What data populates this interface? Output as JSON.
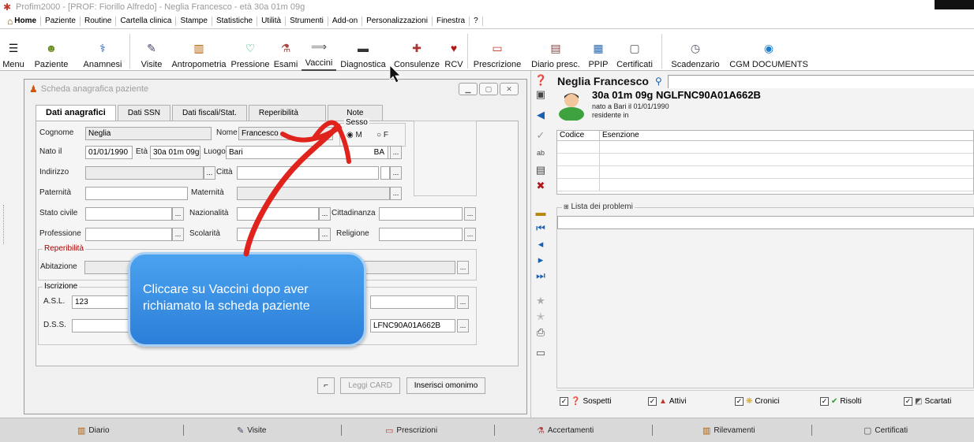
{
  "window": {
    "title": "Profim2000 - [PROF: Fiorillo Alfredo] - Neglia Francesco - età 30a 01m 09g"
  },
  "menu": [
    {
      "label": "Home"
    },
    {
      "label": "Paziente"
    },
    {
      "label": "Routine"
    },
    {
      "label": "Cartella clinica"
    },
    {
      "label": "Stampe"
    },
    {
      "label": "Statistiche"
    },
    {
      "label": "Utilità"
    },
    {
      "label": "Strumenti"
    },
    {
      "label": "Add-on"
    },
    {
      "label": "Personalizzazioni"
    },
    {
      "label": "Finestra"
    },
    {
      "label": "?"
    }
  ],
  "toolbar": [
    {
      "label": "Menu"
    },
    {
      "label": "Paziente"
    },
    {
      "label": "Anamnesi"
    },
    {
      "label": "Visite"
    },
    {
      "label": "Antropometria"
    },
    {
      "label": "Pressione"
    },
    {
      "label": "Esami"
    },
    {
      "label": "Vaccini"
    },
    {
      "label": "Diagnostica"
    },
    {
      "label": "Consulenze"
    },
    {
      "label": "RCV"
    },
    {
      "label": "Prescrizione"
    },
    {
      "label": "Diario presc."
    },
    {
      "label": "PPIP"
    },
    {
      "label": "Certificati"
    },
    {
      "label": "Scadenzario"
    },
    {
      "label": "CGM DOCUMENTS"
    }
  ],
  "scheda": {
    "title": "Scheda anagrafica paziente",
    "tabs": [
      {
        "label": "Dati anagrafici"
      },
      {
        "label": "Dati SSN"
      },
      {
        "label": "Dati fiscali/Stat."
      },
      {
        "label": "Reperibilità"
      },
      {
        "label": "Note"
      }
    ],
    "labels": {
      "cognome": "Cognome",
      "nome": "Nome",
      "sesso": "Sesso",
      "m": "M",
      "f": "F",
      "nato": "Nato il",
      "eta": "Età",
      "luogo": "Luogo",
      "indirizzo": "Indirizzo",
      "citta": "Città",
      "paternita": "Paternità",
      "maternita": "Maternità",
      "stato_civile": "Stato civile",
      "nazionalita": "Nazionalità",
      "cittadinanza": "Cittadinanza",
      "professione": "Professione",
      "scolarita": "Scolarità",
      "religione": "Religione",
      "reperibilita": "Reperibilità",
      "abitazione": "Abitazione",
      "iscrizione": "Iscrizione",
      "asl": "A.S.L.",
      "dss": "D.S.S."
    },
    "values": {
      "cognome": "Neglia",
      "nome": "Francesco",
      "nato": "01/01/1990",
      "eta": "30a 01m 09g",
      "luogo": "Bari",
      "prov": "BA",
      "asl": "123",
      "codice_fiscale": "LFNC90A01A662B"
    },
    "buttons": {
      "leggi_card": "Leggi CARD",
      "inserisci_omonimo": "Inserisci omonimo"
    }
  },
  "callout": {
    "line1": "Cliccare su Vaccini dopo aver",
    "line2": "richiamato la scheda paziente"
  },
  "patient": {
    "name": "Neglia Francesco",
    "header": "30a 01m 09g  NGLFNC90A01A662B",
    "birth": "nato a Bari il 01/01/1990",
    "residence": "residente in"
  },
  "esenzioni": {
    "col_codice": "Codice",
    "col_esenzione": "Esenzione"
  },
  "problemi": {
    "title": "Lista dei problemi",
    "filters": [
      {
        "label": "Sospetti"
      },
      {
        "label": "Attivi"
      },
      {
        "label": "Cronici"
      },
      {
        "label": "Risolti"
      },
      {
        "label": "Scartati"
      }
    ]
  },
  "bottombar": [
    {
      "label": "Diario"
    },
    {
      "label": "Visite"
    },
    {
      "label": "Prescrizioni"
    },
    {
      "label": "Accertamenti"
    },
    {
      "label": "Rilevamenti"
    },
    {
      "label": "Certificati"
    }
  ],
  "colors": {
    "accent_red": "#e0231d",
    "callout_blue": "#2c7fd8"
  }
}
